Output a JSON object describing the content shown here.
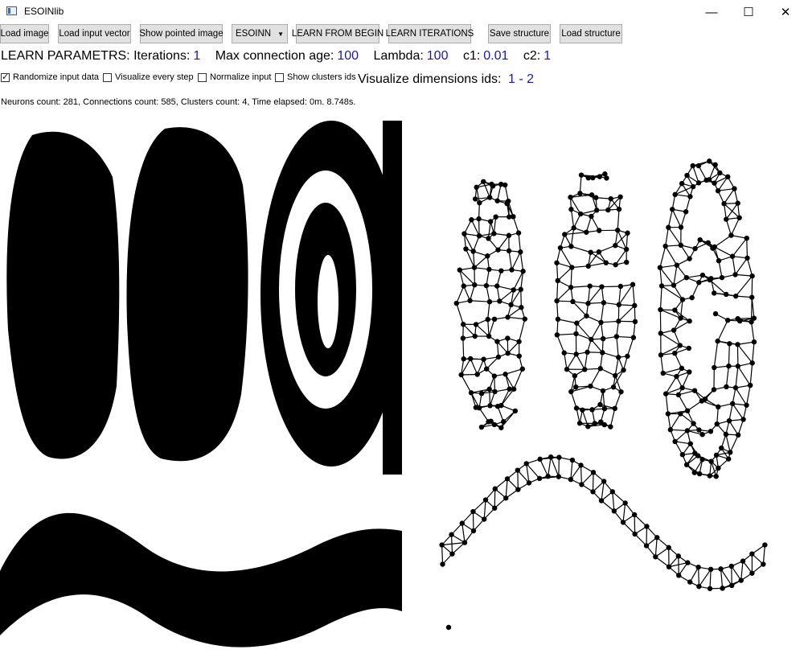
{
  "window": {
    "title": "ESOINlib",
    "minimize": "—",
    "maximize": "☐",
    "close": "✕"
  },
  "toolbar": {
    "load_image": "Load image",
    "load_input_vector": "Load input vector",
    "show_pointed_image": "Show pointed image",
    "algorithm": "ESOINN",
    "learn_from_begin": "LEARN FROM BEGIN",
    "learn_iterations": "LEARN ITERATIONS",
    "save_structure": "Save structure",
    "load_structure": "Load structure"
  },
  "params": {
    "heading": "LEARN PARAMETRS:",
    "iterations_label": "Iterations:",
    "iterations": "1",
    "max_age_label": "Max connection age:",
    "max_age": "100",
    "lambda_label": "Lambda:",
    "lambda": "100",
    "c1_label": "c1:",
    "c1": "0.01",
    "c2_label": "c2:",
    "c2": "1"
  },
  "options": {
    "randomize": {
      "label": "Randomize input data",
      "checked": true,
      "mark": "✓"
    },
    "visualize_every_step": {
      "label": "Visualize every step",
      "checked": false
    },
    "normalize": {
      "label": "Normalize input",
      "checked": false
    },
    "show_clusters": {
      "label": "Show clusters ids",
      "checked": false
    }
  },
  "visualize_dims": {
    "label": "Visualize dimensions ids:",
    "value": "1 - 2"
  },
  "status": "Neurons count: 281, Connections count: 585, Clusters count: 4, Time elapsed: 0m. 8.748s.",
  "colors": {
    "param_value": "#1a1aa6",
    "button_bg": "#e1e1e1",
    "ink": "#000000"
  }
}
